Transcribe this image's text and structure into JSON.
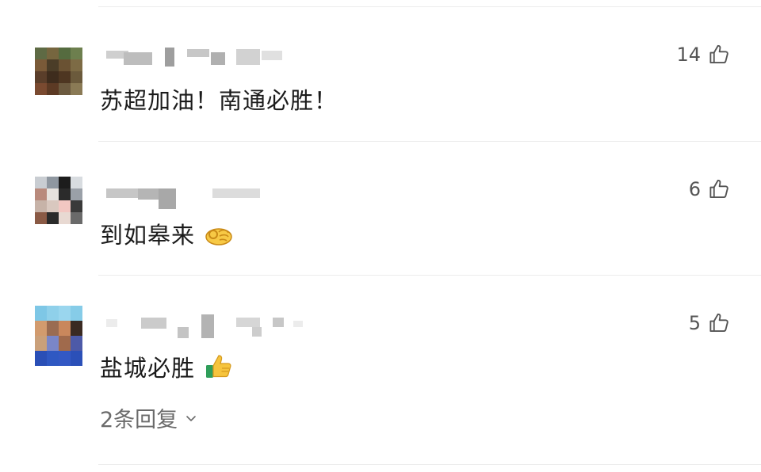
{
  "comments": [
    {
      "text": "苏超加油！南通必胜！",
      "likes": "14",
      "like_icon": "thumbs-up-outline",
      "avatar_colors": [
        "#5e6a44",
        "#76663f",
        "#556b3f",
        "#6d7f4e",
        "#7a5a38",
        "#4b3d28",
        "#6a5233",
        "#7d6b45",
        "#5a3e2a",
        "#3e2c1d",
        "#4e3621",
        "#6b5a3c",
        "#7a4a30",
        "#5c3a24",
        "#6c5a3f",
        "#8a7a55"
      ]
    },
    {
      "text": "到如皋来",
      "likes": "6",
      "emoji": "ok-hand-emoji",
      "like_icon": "thumbs-up-outline",
      "avatar_colors": [
        "#c9cdd2",
        "#8f97a0",
        "#1c1c1c",
        "#d8dce0",
        "#b98a7c",
        "#e7e2de",
        "#2b2b2b",
        "#9aa0a8",
        "#c7b3a8",
        "#d9c8bf",
        "#f2c7c2",
        "#3a3a3a",
        "#8a5a45",
        "#2a2a2a",
        "#e8d9d2",
        "#6a6a6a"
      ]
    },
    {
      "text": "盐城必胜",
      "likes": "5",
      "emoji": "thumbs-up-emoji",
      "like_icon": "thumbs-up-outline",
      "replies_label": "2条回复",
      "avatar_colors": [
        "#7ec7e6",
        "#8fd0ea",
        "#9ad6ee",
        "#86cce8",
        "#d29b6e",
        "#9a6c52",
        "#c9875c",
        "#3a2a22",
        "#caa07a",
        "#7a86c8",
        "#a06a4c",
        "#4d5aa8",
        "#2a4fb6",
        "#2f58c2",
        "#3358c4",
        "#2b50b8"
      ]
    }
  ],
  "colors": {
    "divider": "#ececec",
    "text": "#1b1b1b",
    "meta": "#555555",
    "replies": "#6b6b6b"
  }
}
